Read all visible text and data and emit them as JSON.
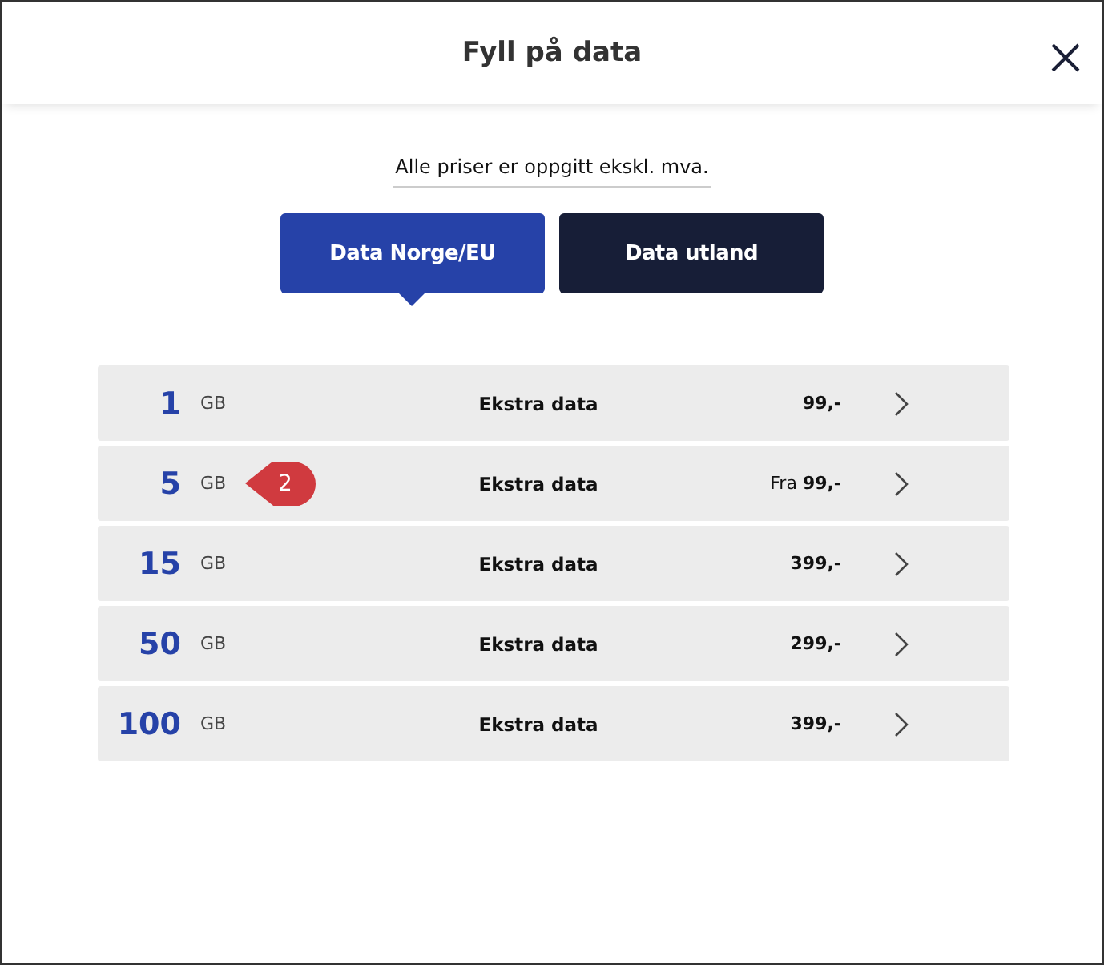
{
  "dialog": {
    "title": "Fyll på data"
  },
  "note": "Alle priser er oppgitt ekskl. mva.",
  "tabs": [
    {
      "label": "Data Norge/EU",
      "selected": true
    },
    {
      "label": "Data utland",
      "selected": false
    }
  ],
  "packages": [
    {
      "amount": "1",
      "unit": "GB",
      "name": "Ekstra data",
      "price": "99,-"
    },
    {
      "amount": "5",
      "unit": "GB",
      "name": "Ekstra data",
      "price": "Fra **99,-**",
      "callout": "2"
    },
    {
      "amount": "15",
      "unit": "GB",
      "name": "Ekstra data",
      "price": "399,-"
    },
    {
      "amount": "50",
      "unit": "GB",
      "name": "Ekstra data",
      "price": "299,-"
    },
    {
      "amount": "100",
      "unit": "GB",
      "name": "Ekstra data",
      "price": "399,-"
    }
  ]
}
